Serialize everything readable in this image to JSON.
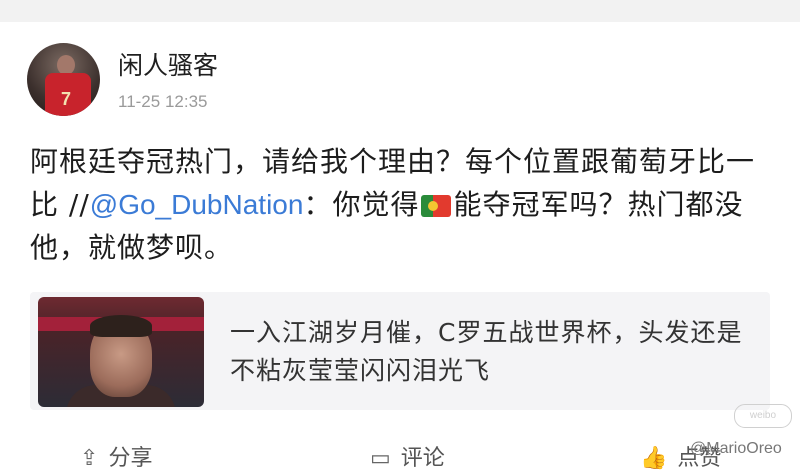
{
  "post": {
    "username": "闲人骚客",
    "timestamp": "11-25 12:35",
    "text_part1": "阿根廷夺冠热门，请给我个理由？每个位置跟葡萄牙比一比 //",
    "mention": "@Go_DubNation",
    "text_part2": "：你觉得",
    "flag_icon": "portugal-flag-icon",
    "text_part3": "能夺冠军吗？热门都没他，就做梦呗。",
    "avatar_number": "7"
  },
  "card": {
    "text": "一入江湖岁月催，C罗五战世界杯，头发还是不粘灰莹莹闪闪泪光飞"
  },
  "actions": {
    "share_label": "分享",
    "comment_label": "评论",
    "like_label": "点赞"
  },
  "watermark": {
    "text": "@MarioOreo",
    "badge_text": "weibo"
  },
  "colors": {
    "mention": "#3b7bd6",
    "card_bg": "#f4f4f6",
    "text": "#1d1d1d",
    "muted": "#9a9a9a"
  }
}
